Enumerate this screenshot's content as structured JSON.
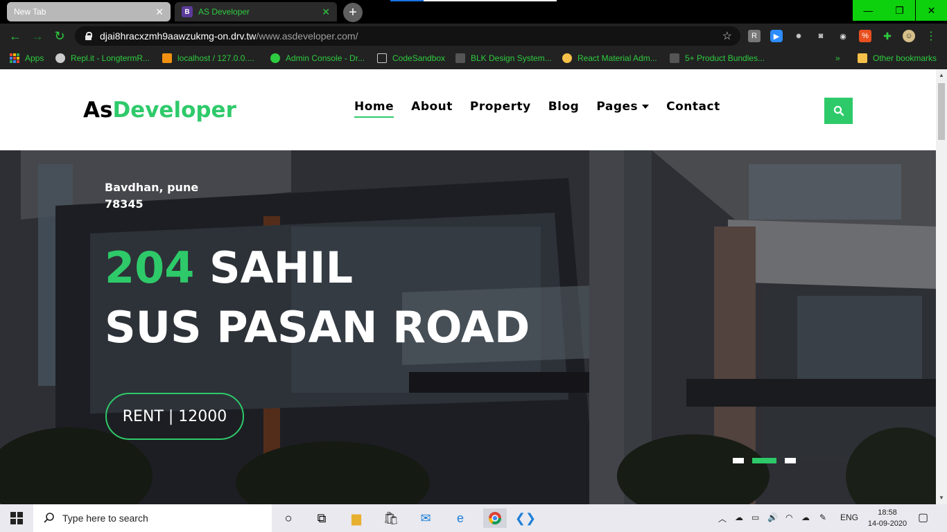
{
  "browser": {
    "tabs": [
      {
        "title": "New Tab",
        "active": false
      },
      {
        "title": "AS Developer",
        "active": true,
        "favicon": "B"
      }
    ],
    "url": {
      "host": "djai8hracxzmh9aawzukmg-on.drv.tw",
      "path": "/www.asdeveloper.com/"
    },
    "bookmarks": [
      {
        "label": "Apps",
        "icon": "apps-grid-icon"
      },
      {
        "label": "Repl.it - LongtermR...",
        "icon": "replit-icon"
      },
      {
        "label": "localhost / 127.0.0....",
        "icon": "phpmyadmin-icon"
      },
      {
        "label": "Admin Console - Dr...",
        "icon": "globe-icon"
      },
      {
        "label": "CodeSandbox",
        "icon": "codesandbox-icon"
      },
      {
        "label": "BLK Design System...",
        "icon": "blk-icon"
      },
      {
        "label": "React Material Adm...",
        "icon": "react-material-icon"
      },
      {
        "label": "5+ Product Bundles...",
        "icon": "bundle-icon"
      }
    ],
    "bookmarks_overflow": "»",
    "other_bookmarks": "Other bookmarks",
    "accent": "#2ecc40"
  },
  "site": {
    "logo_prefix": "As",
    "logo_suffix": "Developer",
    "nav": [
      "Home",
      "About",
      "Property",
      "Blog",
      "Pages",
      "Contact"
    ],
    "active_nav": "Home",
    "accent": "#2eca6a"
  },
  "hero": {
    "address_line1": "Bavdhan, pune",
    "address_line2": "78345",
    "title_number": "204",
    "title_rest": "SAHIL",
    "title_line2": "SUS PASAN ROAD",
    "cta": "RENT | 12000",
    "slides": 3,
    "active_slide": 2
  },
  "taskbar": {
    "search_placeholder": "Type here to search",
    "language": "ENG",
    "time": "18:58",
    "date": "14-09-2020"
  }
}
